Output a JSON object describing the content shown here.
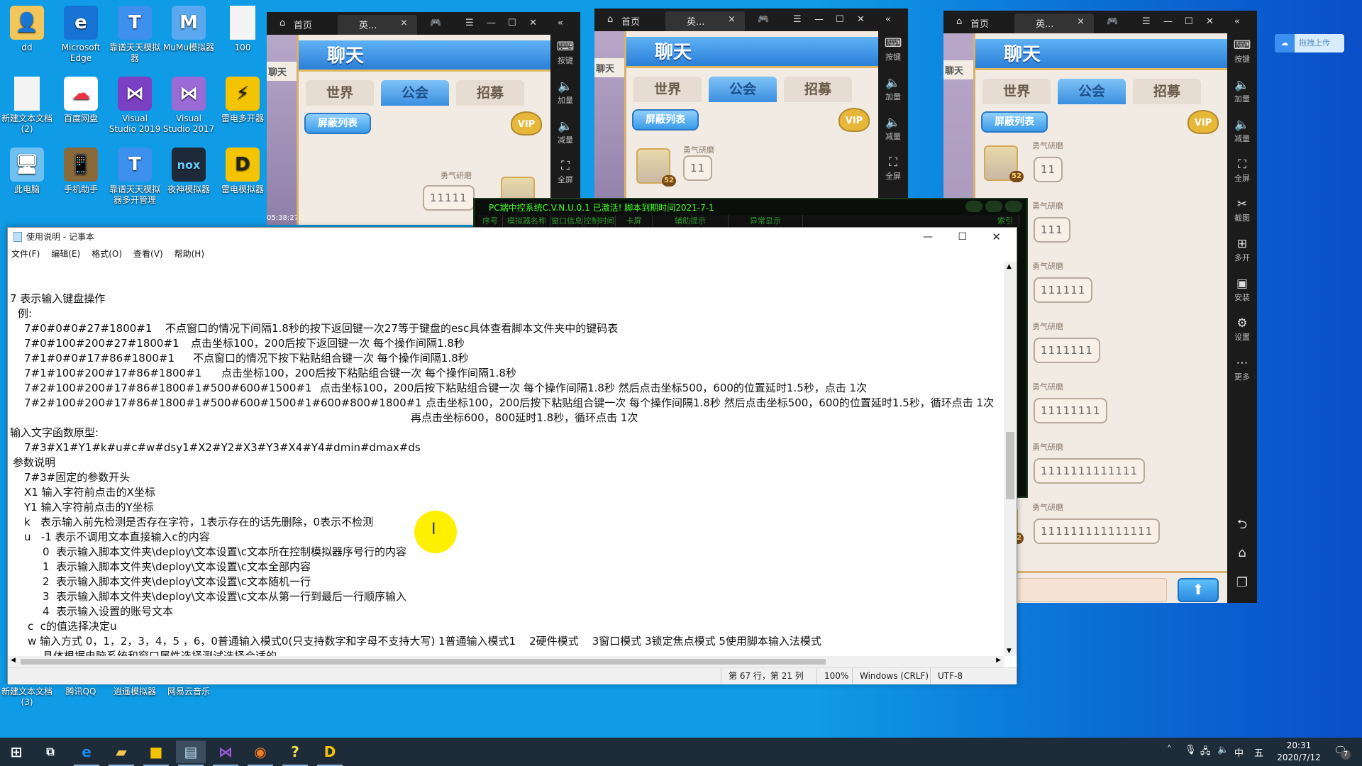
{
  "desktop": {
    "icons": [
      {
        "label": "dd",
        "icon": "user-folder-icon"
      },
      {
        "label": "Microsoft Edge",
        "icon": "edge-icon"
      },
      {
        "label": "靠谱天天模拟器",
        "icon": "android-emulator-icon"
      },
      {
        "label": "MuMu模拟器",
        "icon": "mumu-icon"
      },
      {
        "label": "100",
        "icon": "text-file-icon"
      },
      {
        "label": "新建文本文档 (2)",
        "icon": "text-file-icon"
      },
      {
        "label": "百度网盘",
        "icon": "baidu-netdisk-icon"
      },
      {
        "label": "Visual Studio 2019",
        "icon": "visual-studio-icon"
      },
      {
        "label": "Visual Studio 2017",
        "icon": "visual-studio-icon"
      },
      {
        "label": "雷电多开器",
        "icon": "ldmulti-icon"
      },
      {
        "label": "此电脑",
        "icon": "computer-icon"
      },
      {
        "label": "手机助手",
        "icon": "phone-assistant-icon"
      },
      {
        "label": "靠谱天天模拟器多开管理",
        "icon": "android-emulator-icon"
      },
      {
        "label": "夜神模拟器",
        "icon": "nox-icon"
      },
      {
        "label": "雷电模拟器",
        "icon": "ldplayer-icon"
      }
    ],
    "bottom_labels": [
      "新建文本文档 (3)",
      "腾讯QQ",
      "逍遥模拟器",
      "网易云音乐"
    ],
    "upload_badge": "拖拽上传"
  },
  "emulator": {
    "home_tab": "首页",
    "game_tab": "英...",
    "header": "聊天",
    "tabs": [
      "世界",
      "公会",
      "招募"
    ],
    "active_tab": "公会",
    "block_list": "屏蔽列表",
    "vip": "VIP",
    "side_tab": "聊天",
    "level": "52",
    "sender": "勇气研磨",
    "sidebar": [
      "按键",
      "加量",
      "减量",
      "全屏",
      "截图",
      "多开",
      "安装",
      "设置",
      "更多"
    ]
  },
  "windows": {
    "w1": {
      "time": "05:38:27",
      "messages": [
        "11111"
      ]
    },
    "w2": {
      "messages": [
        "11"
      ]
    },
    "w3": {
      "messages": [
        "11",
        "111",
        "111111",
        "1111111",
        "11111111",
        "1111111111111",
        "111111111111111"
      ]
    }
  },
  "control_app": {
    "title": "PC端中控系统C.V.N.U.0.1 已激活! 脚本到期时间2021-7-1",
    "columns": [
      "序号",
      "模拟器名称",
      "窗口信息",
      "控制时间",
      "卡屏",
      "辅助提示",
      "异常显示",
      "索引"
    ],
    "accent": "#44ff22"
  },
  "notepad": {
    "title": "使用说明 - 记事本",
    "menu": [
      "文件(F)",
      "编辑(E)",
      "格式(O)",
      "查看(V)",
      "帮助(H)"
    ],
    "lines": [
      {
        "text": "7 表示输入键盘操作"
      },
      {
        "text": "例:"
      },
      {
        "code": "7#0#0#0#27#1800#1",
        "desc": "不点窗口的情况下间隔1.8秒的按下返回键一次27等于键盘的esc具体查看脚本文件夹中的键码表"
      },
      {
        "code": "7#0#100#200#27#1800#1",
        "desc": "点击坐标100，200后按下返回键一次 每个操作间隔1.8秒"
      },
      {
        "code": "7#1#0#0#17#86#1800#1",
        "desc": "不点窗口的情况下按下粘贴组合键一次 每个操作间隔1.8秒"
      },
      {
        "code": "7#1#100#200#17#86#1800#1",
        "desc": "点击坐标100，200后按下粘贴组合键一次 每个操作间隔1.8秒"
      },
      {
        "code": "7#2#100#200#17#86#1800#1#500#600#1500#1",
        "desc": "点击坐标100，200后按下粘贴组合键一次 每个操作间隔1.8秒 然后点击坐标500，600的位置延时1.5秒，点击 1次"
      },
      {
        "code": "7#2#100#200#17#86#1800#1#500#600#1500#1#600#800#1800#1",
        "desc": "点击坐标100，200后按下粘贴组合键一次 每个操作间隔1.8秒 然后点击坐标500，600的位置延时1.5秒，循环点击 1次"
      },
      {
        "text": "再点击坐标600，800延时1.8秒，循环点击 1次"
      },
      {
        "text": "输入文字函数原型:"
      },
      {
        "text": "7#3#X1#Y1#k#u#c#w#dsy1#X2#Y2#X3#Y3#X4#Y4#dmin#dmax#ds"
      },
      {
        "text": "参数说明"
      },
      {
        "text": "7#3#固定的参数开头"
      },
      {
        "text": "X1 输入字符前点击的X坐标"
      },
      {
        "text": "Y1 输入字符前点击的Y坐标"
      },
      {
        "text": "k   表示输入前先检测是否存在字符，1表示存在的话先删除，0表示不检测"
      },
      {
        "text": "u   -1 表示不调用文本直接输入c的内容"
      },
      {
        "text": "0  表示输入脚本文件夹\\deploy\\文本设置\\c文本所在控制模拟器序号行的内容"
      },
      {
        "text": "1  表示输入脚本文件夹\\deploy\\文本设置\\c文本全部内容"
      },
      {
        "text": "2  表示输入脚本文件夹\\deploy\\文本设置\\c文本随机一行"
      },
      {
        "text": "3  表示输入脚本文件夹\\deploy\\文本设置\\c文本从第一行到最后一行顺序输入"
      },
      {
        "text": "4  表示输入设置的账号文本"
      },
      {
        "text": "c  c的值选择决定u"
      },
      {
        "text": "w 输入方式 0，1，2，3，4，5 ，6，0普通输入模式0(只支持数字和字母不支持大写) 1普通输入模式1    2硬件模式    3窗口模式 3锁定焦点模式 5使用脚本输入法模式"
      },
      {
        "text": "具体根据电脑系统和窗口属性选择测试选择合适的"
      }
    ],
    "status": {
      "position": "第 67 行，第 21 列",
      "zoom": "100%",
      "line_ending": "Windows (CRLF)",
      "encoding": "UTF-8"
    }
  },
  "taskbar": {
    "apps": [
      "start-icon",
      "task-view-icon",
      "edge-icon",
      "file-explorer-icon",
      "ldmulti-icon",
      "notepad-icon",
      "visual-studio-icon",
      "browser-360-icon",
      "helper-icon",
      "ldplayer-icon"
    ],
    "active": "notepad-icon",
    "tray": {
      "ime": "中",
      "ime_mode": "五",
      "time": "20:31",
      "date": "2020/7/12",
      "notifications": "7"
    }
  }
}
